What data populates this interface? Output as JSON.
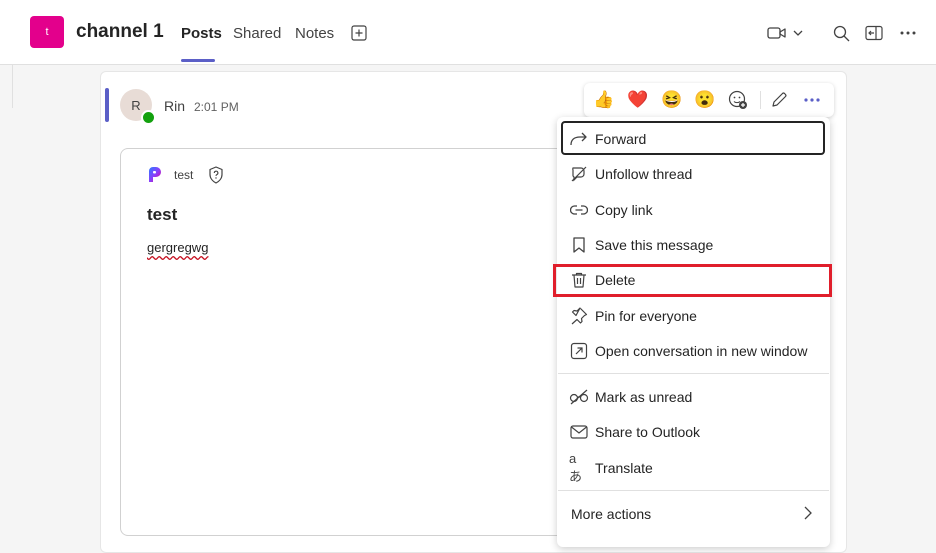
{
  "header": {
    "team_initial": "t",
    "channel_name": "channel 1",
    "tabs": [
      {
        "label": "Posts",
        "active": true
      },
      {
        "label": "Shared",
        "active": false
      },
      {
        "label": "Notes",
        "active": false
      }
    ],
    "icons": [
      "add-tab-icon",
      "video-call-icon",
      "chevron-down-icon",
      "search-icon",
      "side-panel-icon",
      "more-options-icon"
    ]
  },
  "post": {
    "author_initial": "R",
    "author": "Rin",
    "time": "2:01 PM",
    "card": {
      "app_name": "test",
      "title": "test",
      "body": "gergregwg"
    }
  },
  "reactions": [
    "👍",
    "❤️",
    "😆",
    "😮"
  ],
  "context_menu": {
    "items": [
      {
        "label": "Forward",
        "icon": "forward-icon"
      },
      {
        "label": "Unfollow thread",
        "icon": "unfollow-icon"
      },
      {
        "label": "Copy link",
        "icon": "link-icon"
      },
      {
        "label": "Save this message",
        "icon": "bookmark-icon"
      },
      {
        "label": "Delete",
        "icon": "trash-icon"
      },
      {
        "label": "Pin for everyone",
        "icon": "pin-icon"
      },
      {
        "label": "Open conversation in new window",
        "icon": "pop-out-icon"
      },
      {
        "label": "Mark as unread",
        "icon": "unread-icon"
      },
      {
        "label": "Share to Outlook",
        "icon": "mail-icon"
      },
      {
        "label": "Translate",
        "icon": "translate-icon"
      },
      {
        "label": "More actions",
        "icon": "chevron-right-icon"
      }
    ]
  },
  "colors": {
    "accent": "#5b5fc7",
    "team_avatar": "#e3008c",
    "presence": "#13a10e",
    "highlight": "#e01e2b"
  }
}
